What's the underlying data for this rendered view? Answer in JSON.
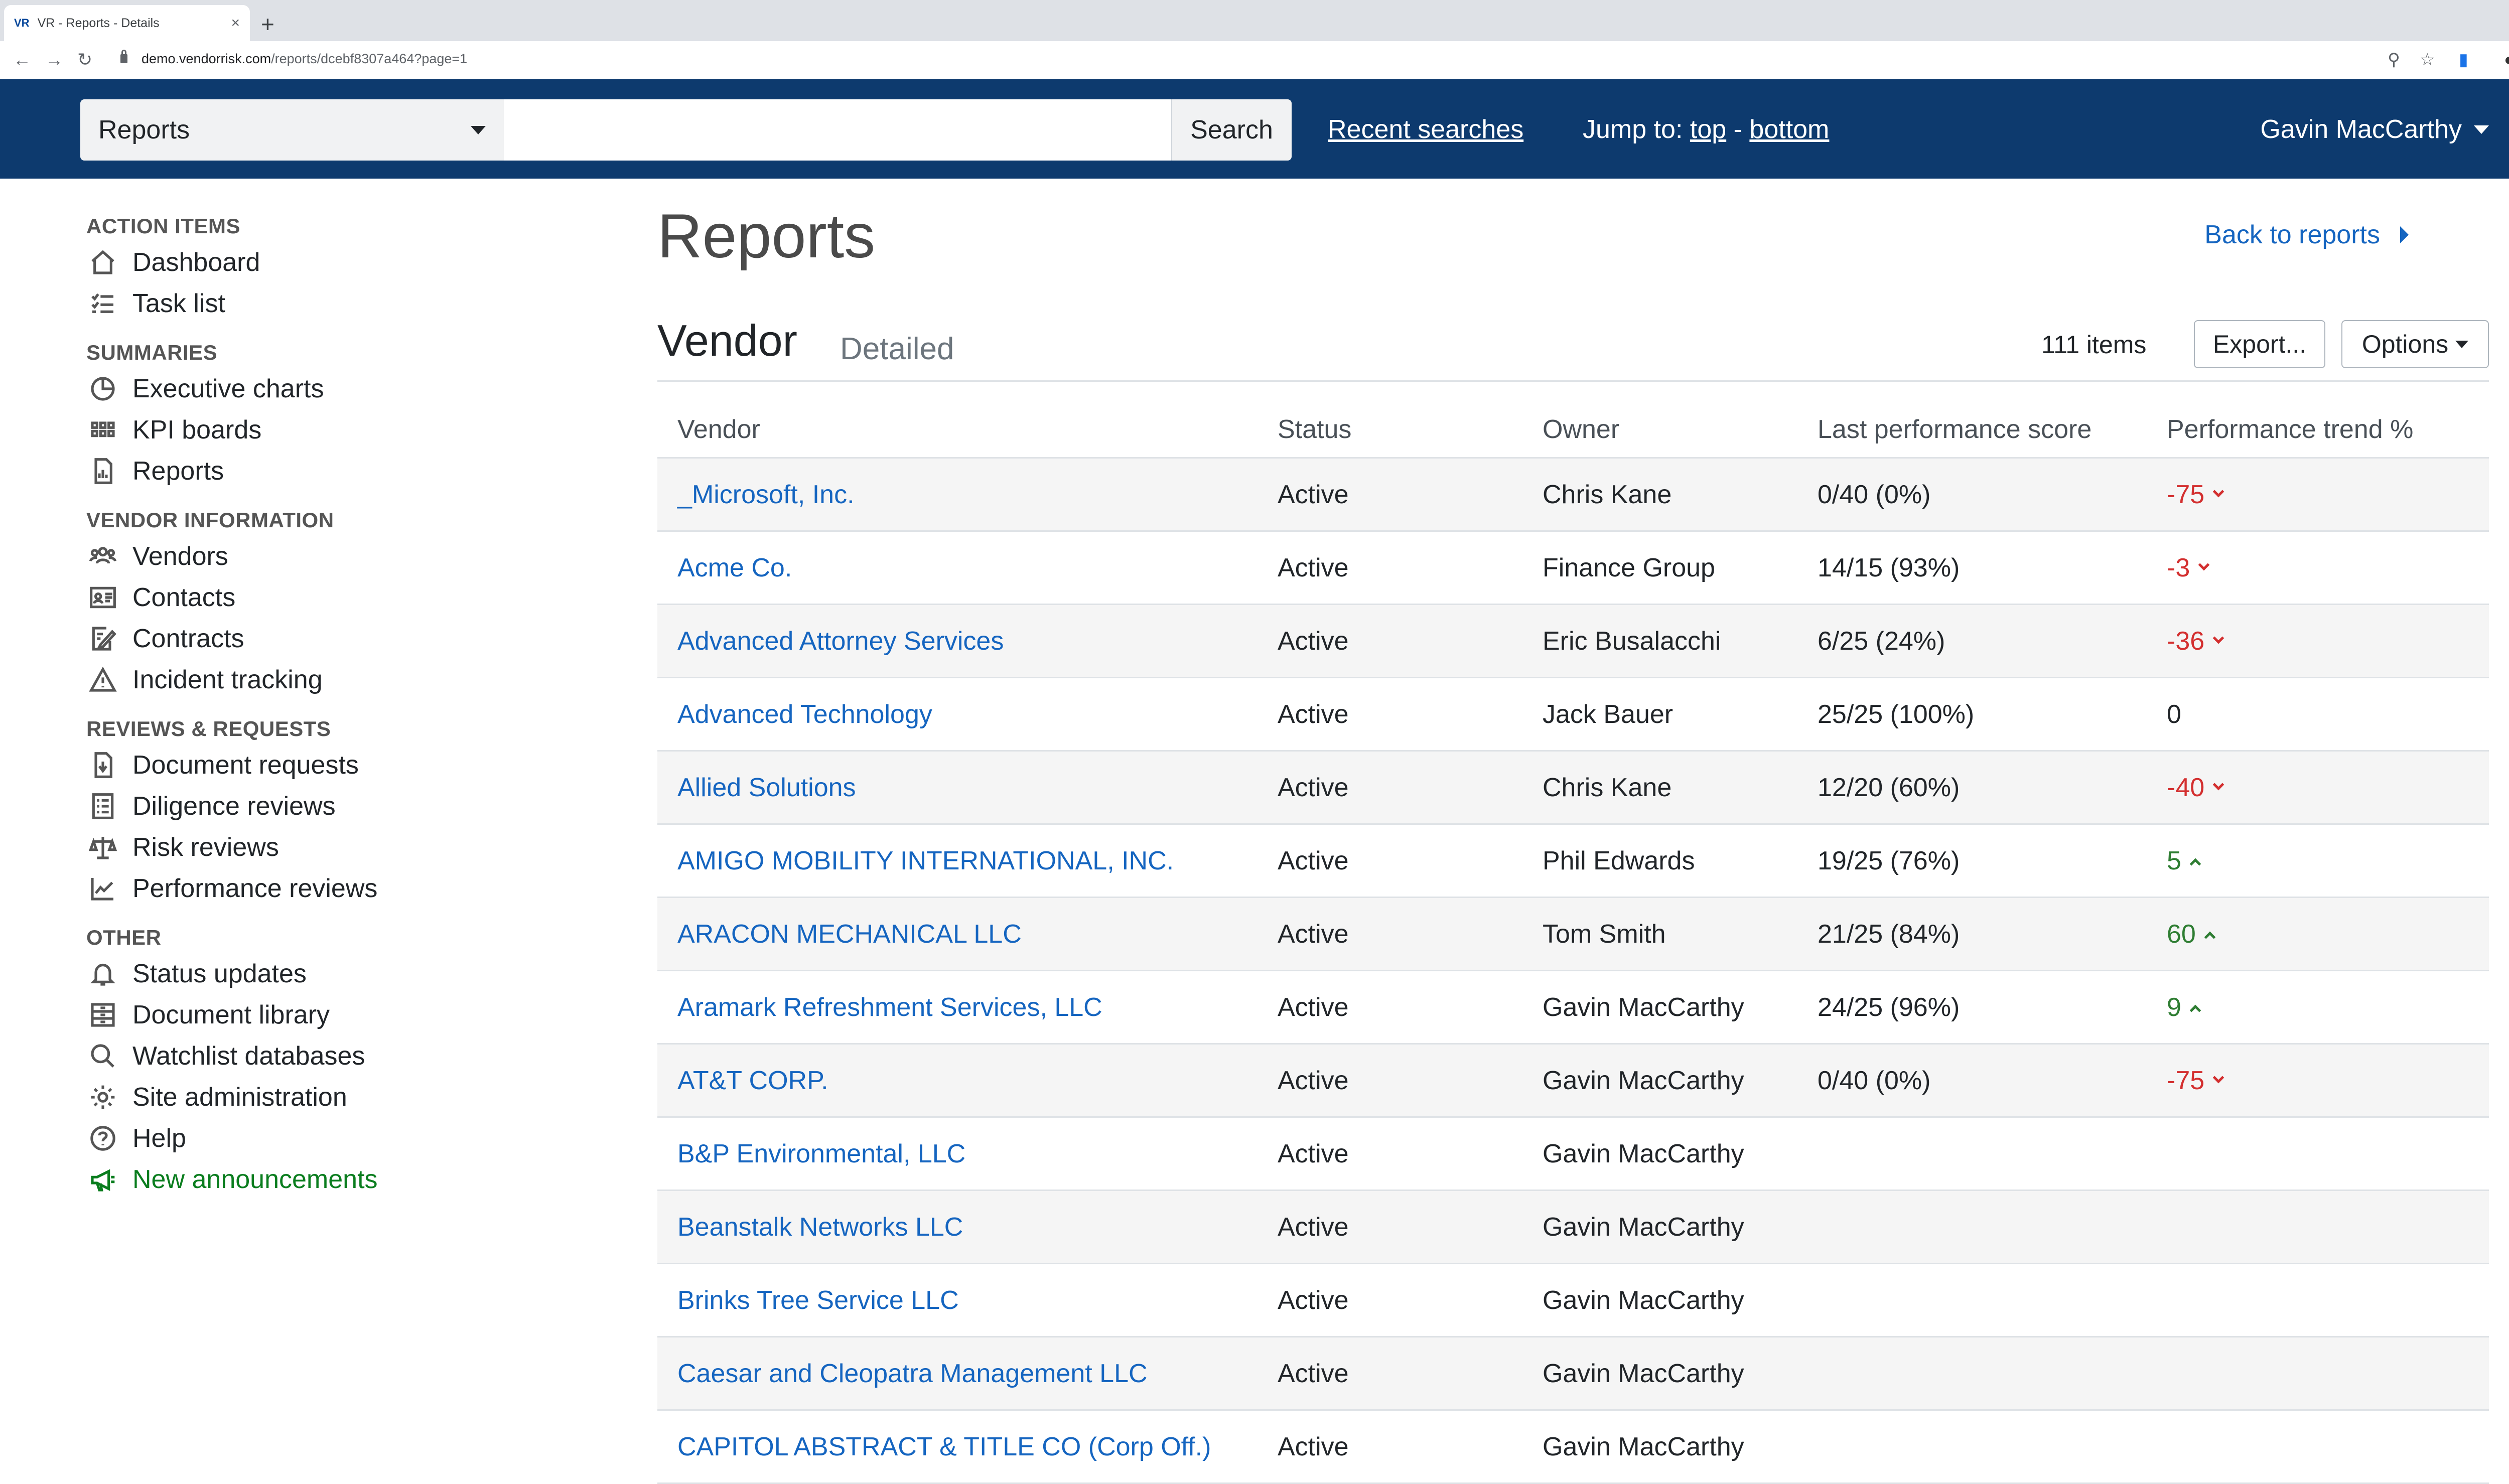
{
  "browser": {
    "tab_favicon": "VR",
    "tab_title": "VR - Reports - Details",
    "tab_close": "×",
    "new_tab": "+",
    "url_host": "demo.vendorrisk.com",
    "url_path": "/reports/dcebf8307a464?page=1"
  },
  "navbar": {
    "search_scope": "Reports",
    "search_value": "",
    "search_button": "Search",
    "recent_searches": "Recent searches",
    "jump_to": "Jump to:",
    "jump_top": "top",
    "jump_separator": "-",
    "jump_bottom": "bottom",
    "user_name": "Gavin MacCarthy"
  },
  "sidebar": {
    "sections": [
      {
        "heading": "ACTION ITEMS",
        "items": [
          {
            "label": "Dashboard",
            "icon": "home-icon"
          },
          {
            "label": "Task list",
            "icon": "task-list-icon"
          }
        ]
      },
      {
        "heading": "SUMMARIES",
        "items": [
          {
            "label": "Executive charts",
            "icon": "pie-chart-icon"
          },
          {
            "label": "KPI boards",
            "icon": "grid-icon"
          },
          {
            "label": "Reports",
            "icon": "report-icon"
          }
        ]
      },
      {
        "heading": "VENDOR INFORMATION",
        "items": [
          {
            "label": "Vendors",
            "icon": "people-icon"
          },
          {
            "label": "Contacts",
            "icon": "contact-card-icon"
          },
          {
            "label": "Contracts",
            "icon": "contract-icon"
          },
          {
            "label": "Incident tracking",
            "icon": "warning-icon"
          }
        ]
      },
      {
        "heading": "REVIEWS & REQUESTS",
        "items": [
          {
            "label": "Document requests",
            "icon": "document-request-icon"
          },
          {
            "label": "Diligence reviews",
            "icon": "checklist-icon"
          },
          {
            "label": "Risk reviews",
            "icon": "scale-icon"
          },
          {
            "label": "Performance reviews",
            "icon": "line-chart-icon"
          }
        ]
      },
      {
        "heading": "OTHER",
        "items": [
          {
            "label": "Status updates",
            "icon": "bell-icon"
          },
          {
            "label": "Document library",
            "icon": "library-icon"
          },
          {
            "label": "Watchlist databases",
            "icon": "search-icon"
          },
          {
            "label": "Site administration",
            "icon": "gear-icon"
          },
          {
            "label": "Help",
            "icon": "help-icon"
          },
          {
            "label": "New announcements",
            "icon": "megaphone-icon",
            "color": "#0a7d1e"
          }
        ]
      }
    ]
  },
  "main": {
    "title": "Reports",
    "back_link": "Back to reports",
    "section_title": "Vendor",
    "section_subtitle": "Detailed",
    "item_count": "111 items",
    "export_button": "Export...",
    "options_button": "Options",
    "columns": [
      "Vendor",
      "Status",
      "Owner",
      "Last performance score",
      "Performance trend %"
    ],
    "rows": [
      {
        "vendor": "_Microsoft, Inc.",
        "status": "Active",
        "owner": "Chris Kane",
        "score": "0/40 (0%)",
        "trend": "-75",
        "dir": "down"
      },
      {
        "vendor": "Acme Co.",
        "status": "Active",
        "owner": "Finance Group",
        "score": "14/15 (93%)",
        "trend": "-3",
        "dir": "down"
      },
      {
        "vendor": "Advanced Attorney Services",
        "status": "Active",
        "owner": "Eric Busalacchi",
        "score": "6/25 (24%)",
        "trend": "-36",
        "dir": "down"
      },
      {
        "vendor": "Advanced Technology",
        "status": "Active",
        "owner": "Jack Bauer",
        "score": "25/25 (100%)",
        "trend": "0",
        "dir": "flat"
      },
      {
        "vendor": "Allied Solutions",
        "status": "Active",
        "owner": "Chris Kane",
        "score": "12/20 (60%)",
        "trend": "-40",
        "dir": "down"
      },
      {
        "vendor": "AMIGO MOBILITY INTERNATIONAL, INC.",
        "status": "Active",
        "owner": "Phil Edwards",
        "score": "19/25 (76%)",
        "trend": "5",
        "dir": "up"
      },
      {
        "vendor": "ARACON MECHANICAL LLC",
        "status": "Active",
        "owner": "Tom Smith",
        "score": "21/25 (84%)",
        "trend": "60",
        "dir": "up"
      },
      {
        "vendor": "Aramark Refreshment Services, LLC",
        "status": "Active",
        "owner": "Gavin MacCarthy",
        "score": "24/25 (96%)",
        "trend": "9",
        "dir": "up"
      },
      {
        "vendor": "AT&T CORP.",
        "status": "Active",
        "owner": "Gavin MacCarthy",
        "score": "0/40 (0%)",
        "trend": "-75",
        "dir": "down"
      },
      {
        "vendor": "B&P Environmental, LLC",
        "status": "Active",
        "owner": "Gavin MacCarthy",
        "score": "",
        "trend": "",
        "dir": "none"
      },
      {
        "vendor": "Beanstalk Networks LLC",
        "status": "Active",
        "owner": "Gavin MacCarthy",
        "score": "",
        "trend": "",
        "dir": "none"
      },
      {
        "vendor": "Brinks Tree Service LLC",
        "status": "Active",
        "owner": "Gavin MacCarthy",
        "score": "",
        "trend": "",
        "dir": "none"
      },
      {
        "vendor": "Caesar and Cleopatra Management LLC",
        "status": "Active",
        "owner": "Gavin MacCarthy",
        "score": "",
        "trend": "",
        "dir": "none"
      },
      {
        "vendor": "CAPITOL ABSTRACT & TITLE CO (Corp Off.)",
        "status": "Active",
        "owner": "Gavin MacCarthy",
        "score": "",
        "trend": "",
        "dir": "none"
      }
    ]
  },
  "colors": {
    "navbar": "#0d3a6e",
    "link": "#1565c0",
    "negative": "#d32f2f",
    "positive": "#2e7d32",
    "announcement": "#0a7d1e"
  }
}
